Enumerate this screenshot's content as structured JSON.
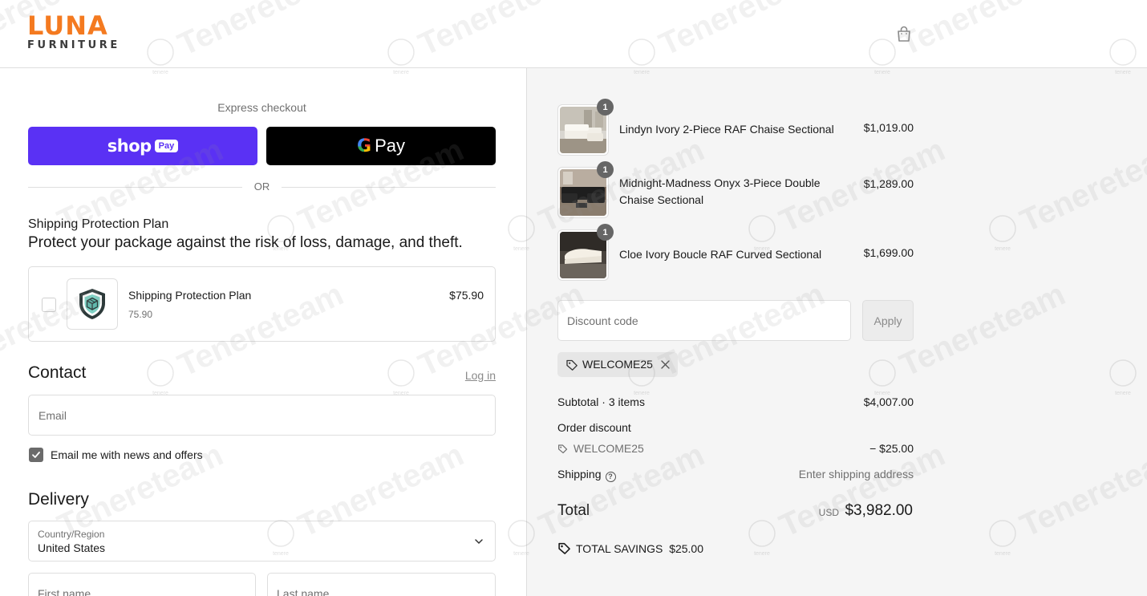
{
  "header": {
    "logo_top": "LUNA",
    "logo_bottom": "FURNITURE",
    "cart_icon": "shopping-bag-icon"
  },
  "express": {
    "label": "Express checkout",
    "shop_pay_word": "shop",
    "shop_pay_pill": "Pay",
    "gpay_g": "G",
    "gpay_word": "Pay",
    "or": "OR"
  },
  "protection": {
    "title": "Shipping Protection Plan",
    "subtitle": "Protect your package against the risk of loss, damage, and theft.",
    "item_name": "Shipping Protection Plan",
    "item_mini_price": "75.90",
    "item_price": "$75.90",
    "checked": false,
    "icon": "shield-box-icon"
  },
  "contact": {
    "heading": "Contact",
    "login": "Log in",
    "email_placeholder": "Email",
    "newsletter_label": "Email me with news and offers",
    "newsletter_checked": true
  },
  "delivery": {
    "heading": "Delivery",
    "country_caption": "Country/Region",
    "country_value": "United States",
    "first_name_placeholder": "First name",
    "last_name_placeholder": "Last name"
  },
  "cart": {
    "items": [
      {
        "name": "Lindyn Ivory 2-Piece RAF Chaise Sectional",
        "price": "$1,019.00",
        "qty": "1"
      },
      {
        "name": "Midnight-Madness Onyx 3-Piece Double Chaise Sectional",
        "price": "$1,289.00",
        "qty": "1"
      },
      {
        "name": "Cloe Ivory Boucle RAF Curved Sectional",
        "price": "$1,699.00",
        "qty": "1"
      }
    ],
    "discount_placeholder": "Discount code",
    "apply_label": "Apply",
    "applied_code": "WELCOME25"
  },
  "summary": {
    "subtotal_label": "Subtotal · 3 items",
    "subtotal_value": "$4,007.00",
    "order_discount_label": "Order discount",
    "discount_code": "WELCOME25",
    "discount_value": "− $25.00",
    "shipping_label": "Shipping",
    "shipping_help": "?",
    "shipping_value": "Enter shipping address",
    "total_label": "Total",
    "currency": "USD",
    "total_value": "$3,982.00",
    "savings_label": "TOTAL SAVINGS",
    "savings_value": "$25.00"
  },
  "watermark": {
    "text": "Tenereteam",
    "seal_text": "tenere"
  },
  "colors": {
    "brand_orange": "#f47a20",
    "shop_pay_purple": "#5a31f4",
    "gpay_black": "#000000",
    "summary_bg": "#f5f5f5"
  }
}
